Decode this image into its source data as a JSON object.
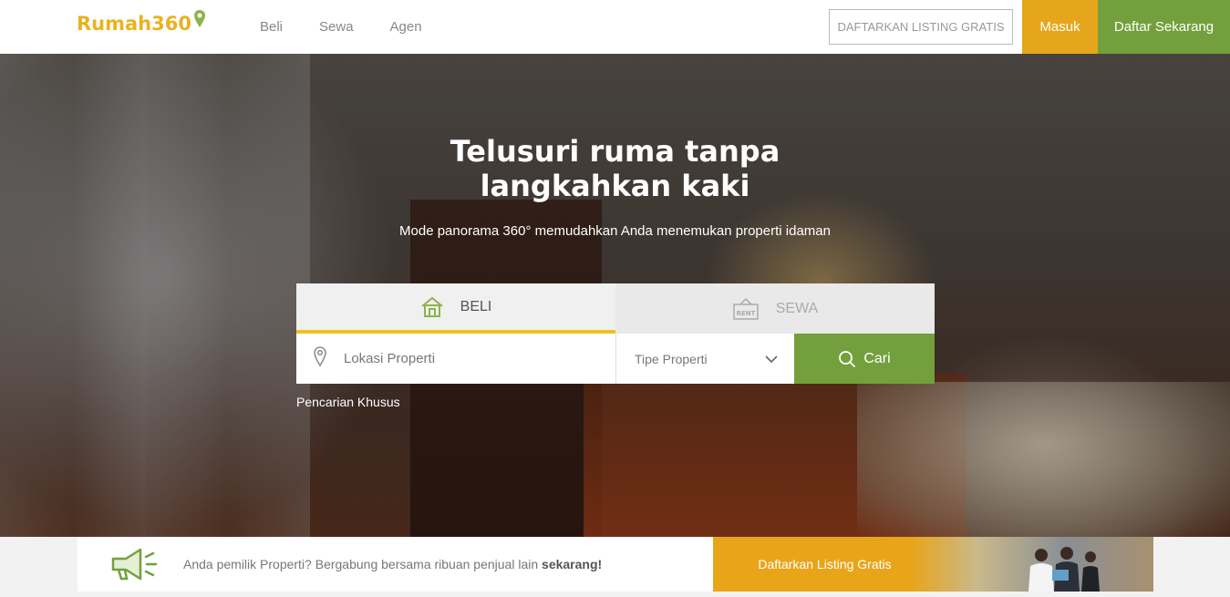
{
  "header": {
    "logo_text": "Rumah360",
    "nav": [
      {
        "label": "Beli"
      },
      {
        "label": "Sewa"
      },
      {
        "label": "Agen"
      }
    ],
    "listing_button": "DAFTARKAN LISTING GRATIS",
    "login_button": "Masuk",
    "register_button": "Daftar Sekarang"
  },
  "hero": {
    "title_line1": "Telusuri ruma  tanpa",
    "title_line2": "langkahkan kaki",
    "subtitle": "Mode panorama 360° memudahkan Anda menemukan properti idaman"
  },
  "search": {
    "tabs": [
      {
        "label": "BELI",
        "icon": "house-icon",
        "active": true
      },
      {
        "label": "SEWA",
        "icon": "rent-sign-icon",
        "active": false
      }
    ],
    "location_placeholder": "Lokasi Properti",
    "property_type": "Tipe Properti",
    "search_button": "Cari",
    "advanced_link": "Pencarian Khusus"
  },
  "banner": {
    "text": "Anda pemilik Properti? Bergabung bersama ribuan penjual lain ",
    "text_bold": "sekarang!",
    "cta": "Daftarkan Listing Gratis"
  },
  "colors": {
    "brand_yellow": "#e8b321",
    "login_orange": "#e6a61b",
    "green": "#73a03c",
    "tab_underline": "#f0c020"
  }
}
